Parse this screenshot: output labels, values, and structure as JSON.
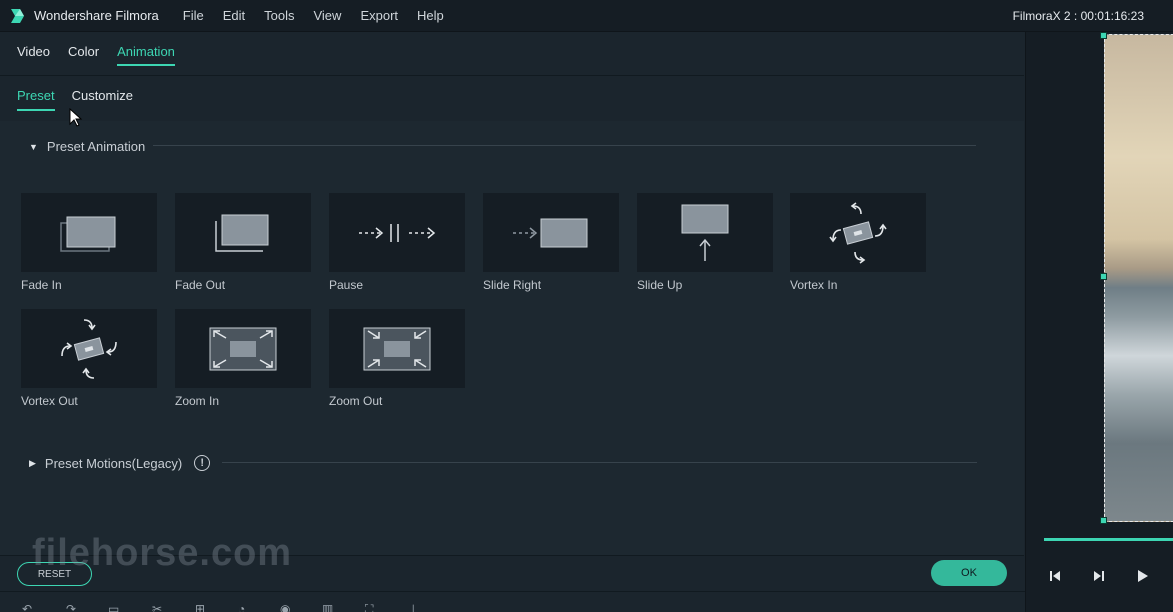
{
  "titlebar": {
    "app_name": "Wondershare Filmora",
    "menu": [
      "File",
      "Edit",
      "Tools",
      "View",
      "Export",
      "Help"
    ],
    "project_status": "FilmoraX 2 : 00:01:16:23"
  },
  "tabs": [
    "Video",
    "Color",
    "Animation"
  ],
  "active_tab": "Animation",
  "subtabs": [
    "Preset",
    "Customize"
  ],
  "active_subtab": "Preset",
  "preset_section": {
    "title": "Preset Animation",
    "expanded": true,
    "items": [
      {
        "label": "Fade In",
        "icon": "fade-in-icon"
      },
      {
        "label": "Fade Out",
        "icon": "fade-out-icon"
      },
      {
        "label": "Pause",
        "icon": "pause-icon"
      },
      {
        "label": "Slide Right",
        "icon": "slide-right-icon"
      },
      {
        "label": "Slide Up",
        "icon": "slide-up-icon"
      },
      {
        "label": "Vortex In",
        "icon": "vortex-in-icon"
      },
      {
        "label": "Vortex Out",
        "icon": "vortex-out-icon"
      },
      {
        "label": "Zoom In",
        "icon": "zoom-in-icon"
      },
      {
        "label": "Zoom Out",
        "icon": "zoom-out-icon"
      }
    ]
  },
  "legacy_section": {
    "title": "Preset Motions(Legacy)",
    "expanded": false,
    "info_icon": "info-icon"
  },
  "buttons": {
    "reset": "RESET",
    "ok": "OK"
  },
  "watermark": "filehorse.com",
  "colors": {
    "accent": "#3dd6b3",
    "background": "#1d2830",
    "tile": "#151d24"
  }
}
